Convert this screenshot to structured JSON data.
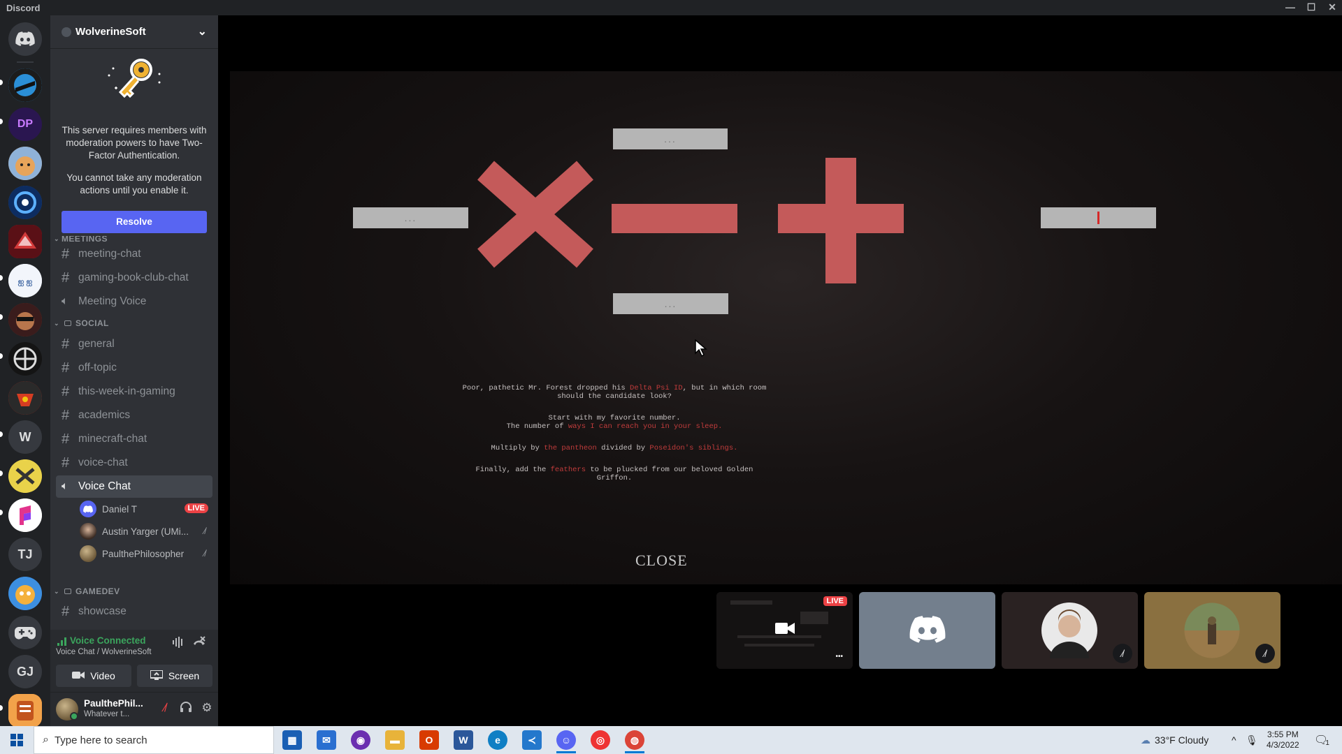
{
  "titlebar": {
    "app_name": "Discord",
    "minimize": "—",
    "maximize": "☐",
    "close": "✕"
  },
  "rail": {
    "servers": [
      {
        "name": "home",
        "glyph": "",
        "color": "#36393f"
      },
      {
        "name": "server-1",
        "glyph": "",
        "color": "#2b8fd6"
      },
      {
        "name": "server-2",
        "glyph": "DP",
        "color": "#6d3fc4"
      },
      {
        "name": "server-3",
        "glyph": "",
        "color": "#c9863c"
      },
      {
        "name": "server-4",
        "glyph": "",
        "color": "#1d4f9c"
      },
      {
        "name": "server-5",
        "glyph": "",
        "color": "#a8242c"
      },
      {
        "name": "server-6",
        "glyph": "",
        "color": "#e8eef8"
      },
      {
        "name": "server-7",
        "glyph": "",
        "color": "#8a3a2a"
      },
      {
        "name": "server-8",
        "glyph": "",
        "color": "#1a1a1a"
      },
      {
        "name": "server-9",
        "glyph": "",
        "color": "#b72c1e"
      },
      {
        "name": "server-10",
        "glyph": "W",
        "color": "#36393f"
      },
      {
        "name": "server-11",
        "glyph": "",
        "color": "#d8c23a"
      },
      {
        "name": "server-12",
        "glyph": "",
        "color": "#e23a8a"
      },
      {
        "name": "server-13",
        "glyph": "TJ",
        "color": "#36393f"
      },
      {
        "name": "server-14",
        "glyph": "",
        "color": "#2e7fd0"
      },
      {
        "name": "server-15",
        "glyph": "",
        "color": "#36393f"
      },
      {
        "name": "server-16",
        "glyph": "GJ",
        "color": "#36393f"
      },
      {
        "name": "server-17",
        "glyph": "",
        "color": "#e08a3c"
      }
    ]
  },
  "guild": {
    "name": "WolverineSoft",
    "notice_text_1": "This server requires members with moderation powers to have Two-Factor Authentication.",
    "notice_text_2": "You cannot take any moderation actions until you enable it.",
    "resolve_label": "Resolve"
  },
  "channels": {
    "partial_category": "MEETINGS",
    "meeting_chat": "meeting-chat",
    "gaming_book": "gaming-book-club-chat",
    "meeting_voice": "Meeting Voice",
    "social_category": "SOCIAL",
    "general": "general",
    "off_topic": "off-topic",
    "this_week": "this-week-in-gaming",
    "academics": "academics",
    "minecraft": "minecraft-chat",
    "voice_chat_text": "voice-chat",
    "voice_chat": "Voice Chat",
    "gamedev_category": "GAMEDEV",
    "showcase": "showcase"
  },
  "voice_users": [
    {
      "name": "Daniel T",
      "badge": "LIVE"
    },
    {
      "name": "Austin Yarger (UMi...",
      "badge": ""
    },
    {
      "name": "PaulthePhilosopher",
      "badge": ""
    }
  ],
  "voice_panel": {
    "status": "Voice Connected",
    "location": "Voice Chat / WolverineSoft",
    "video_label": "Video",
    "screen_label": "Screen"
  },
  "user_panel": {
    "name": "PaulthePhil...",
    "status": "Whatever t..."
  },
  "game": {
    "box_dots": "...",
    "riddle_1a": "Poor, pathetic Mr. Forest dropped his ",
    "riddle_1_red": "Delta Psi ID",
    "riddle_1b": ", but in which room should the candidate look?",
    "riddle_2a": "Start with my favorite number.",
    "riddle_2b": "The number of ",
    "riddle_2_red": "ways I can reach you in your sleep.",
    "riddle_3a": "Multiply by ",
    "riddle_3_red1": "the pantheon",
    "riddle_3b": " divided by ",
    "riddle_3_red2": "Poseidon's siblings.",
    "riddle_4a": "Finally, add the ",
    "riddle_4_red": "feathers",
    "riddle_4b": " to be plucked from our beloved Golden Griffon.",
    "close_label": "CLOSE"
  },
  "tiles": {
    "live_label": "LIVE",
    "more": "•••"
  },
  "taskbar": {
    "search_placeholder": "Type here to search",
    "weather": "33°F  Cloudy",
    "time": "3:55 PM",
    "date": "4/3/2022",
    "notifications": "1"
  },
  "colors": {
    "accent": "#5865f2",
    "live": "#ed4245",
    "connected": "#3ba55d",
    "symbol": "#c45a5a"
  }
}
